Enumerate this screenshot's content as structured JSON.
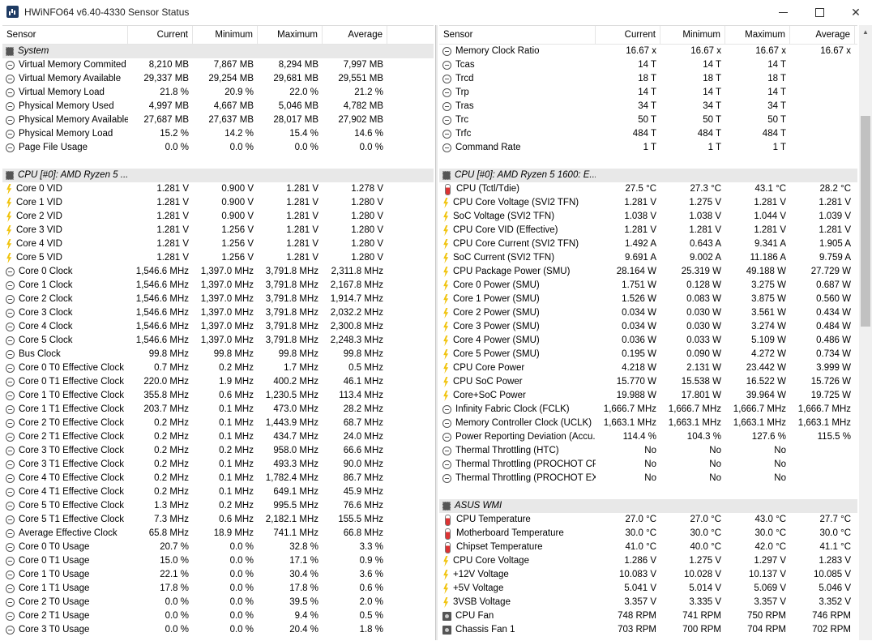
{
  "window": {
    "title": "HWiNFO64 v6.40-4330 Sensor Status",
    "minimize": "minimize",
    "maximize": "maximize",
    "close": "✕"
  },
  "columns": {
    "sensor": "Sensor",
    "current": "Current",
    "minimum": "Minimum",
    "maximum": "Maximum",
    "average": "Average"
  },
  "left_rows": [
    {
      "type": "group",
      "icon": "chip-icon",
      "name": "System"
    },
    {
      "type": "row",
      "icon": "mem-icon",
      "name": "Virtual Memory Commited",
      "current": "8,210 MB",
      "minimum": "7,867 MB",
      "maximum": "8,294 MB",
      "average": "7,997 MB"
    },
    {
      "type": "row",
      "icon": "mem-icon",
      "name": "Virtual Memory Available",
      "current": "29,337 MB",
      "minimum": "29,254 MB",
      "maximum": "29,681 MB",
      "average": "29,551 MB"
    },
    {
      "type": "row",
      "icon": "mem-icon",
      "name": "Virtual Memory Load",
      "current": "21.8 %",
      "minimum": "20.9 %",
      "maximum": "22.0 %",
      "average": "21.2 %"
    },
    {
      "type": "row",
      "icon": "mem-icon",
      "name": "Physical Memory Used",
      "current": "4,997 MB",
      "minimum": "4,667 MB",
      "maximum": "5,046 MB",
      "average": "4,782 MB"
    },
    {
      "type": "row",
      "icon": "mem-icon",
      "name": "Physical Memory Available",
      "current": "27,687 MB",
      "minimum": "27,637 MB",
      "maximum": "28,017 MB",
      "average": "27,902 MB"
    },
    {
      "type": "row",
      "icon": "mem-icon",
      "name": "Physical Memory Load",
      "current": "15.2 %",
      "minimum": "14.2 %",
      "maximum": "15.4 %",
      "average": "14.6 %"
    },
    {
      "type": "row",
      "icon": "mem-icon",
      "name": "Page File Usage",
      "current": "0.0 %",
      "minimum": "0.0 %",
      "maximum": "0.0 %",
      "average": "0.0 %"
    },
    {
      "type": "spacer"
    },
    {
      "type": "group",
      "icon": "chip-icon",
      "name": "CPU [#0]: AMD Ryzen 5 ..."
    },
    {
      "type": "row",
      "icon": "volt-icon",
      "name": "Core 0 VID",
      "current": "1.281 V",
      "minimum": "0.900 V",
      "maximum": "1.281 V",
      "average": "1.278 V"
    },
    {
      "type": "row",
      "icon": "volt-icon",
      "name": "Core 1 VID",
      "current": "1.281 V",
      "minimum": "0.900 V",
      "maximum": "1.281 V",
      "average": "1.280 V"
    },
    {
      "type": "row",
      "icon": "volt-icon",
      "name": "Core 2 VID",
      "current": "1.281 V",
      "minimum": "0.900 V",
      "maximum": "1.281 V",
      "average": "1.280 V"
    },
    {
      "type": "row",
      "icon": "volt-icon",
      "name": "Core 3 VID",
      "current": "1.281 V",
      "minimum": "1.256 V",
      "maximum": "1.281 V",
      "average": "1.280 V"
    },
    {
      "type": "row",
      "icon": "volt-icon",
      "name": "Core 4 VID",
      "current": "1.281 V",
      "minimum": "1.256 V",
      "maximum": "1.281 V",
      "average": "1.280 V"
    },
    {
      "type": "row",
      "icon": "volt-icon",
      "name": "Core 5 VID",
      "current": "1.281 V",
      "minimum": "1.256 V",
      "maximum": "1.281 V",
      "average": "1.280 V"
    },
    {
      "type": "row",
      "icon": "clock-icon",
      "name": "Core 0 Clock",
      "current": "1,546.6 MHz",
      "minimum": "1,397.0 MHz",
      "maximum": "3,791.8 MHz",
      "average": "2,311.8 MHz"
    },
    {
      "type": "row",
      "icon": "clock-icon",
      "name": "Core 1 Clock",
      "current": "1,546.6 MHz",
      "minimum": "1,397.0 MHz",
      "maximum": "3,791.8 MHz",
      "average": "2,167.8 MHz"
    },
    {
      "type": "row",
      "icon": "clock-icon",
      "name": "Core 2 Clock",
      "current": "1,546.6 MHz",
      "minimum": "1,397.0 MHz",
      "maximum": "3,791.8 MHz",
      "average": "1,914.7 MHz"
    },
    {
      "type": "row",
      "icon": "clock-icon",
      "name": "Core 3 Clock",
      "current": "1,546.6 MHz",
      "minimum": "1,397.0 MHz",
      "maximum": "3,791.8 MHz",
      "average": "2,032.2 MHz"
    },
    {
      "type": "row",
      "icon": "clock-icon",
      "name": "Core 4 Clock",
      "current": "1,546.6 MHz",
      "minimum": "1,397.0 MHz",
      "maximum": "3,791.8 MHz",
      "average": "2,300.8 MHz"
    },
    {
      "type": "row",
      "icon": "clock-icon",
      "name": "Core 5 Clock",
      "current": "1,546.6 MHz",
      "minimum": "1,397.0 MHz",
      "maximum": "3,791.8 MHz",
      "average": "2,248.3 MHz"
    },
    {
      "type": "row",
      "icon": "clock-icon",
      "name": "Bus Clock",
      "current": "99.8 MHz",
      "minimum": "99.8 MHz",
      "maximum": "99.8 MHz",
      "average": "99.8 MHz"
    },
    {
      "type": "row",
      "icon": "clock-icon",
      "name": "Core 0 T0 Effective Clock",
      "current": "0.7 MHz",
      "minimum": "0.2 MHz",
      "maximum": "1.7 MHz",
      "average": "0.5 MHz"
    },
    {
      "type": "row",
      "icon": "clock-icon",
      "name": "Core 0 T1 Effective Clock",
      "current": "220.0 MHz",
      "minimum": "1.9 MHz",
      "maximum": "400.2 MHz",
      "average": "46.1 MHz"
    },
    {
      "type": "row",
      "icon": "clock-icon",
      "name": "Core 1 T0 Effective Clock",
      "current": "355.8 MHz",
      "minimum": "0.6 MHz",
      "maximum": "1,230.5 MHz",
      "average": "113.4 MHz"
    },
    {
      "type": "row",
      "icon": "clock-icon",
      "name": "Core 1 T1 Effective Clock",
      "current": "203.7 MHz",
      "minimum": "0.1 MHz",
      "maximum": "473.0 MHz",
      "average": "28.2 MHz"
    },
    {
      "type": "row",
      "icon": "clock-icon",
      "name": "Core 2 T0 Effective Clock",
      "current": "0.2 MHz",
      "minimum": "0.1 MHz",
      "maximum": "1,443.9 MHz",
      "average": "68.7 MHz"
    },
    {
      "type": "row",
      "icon": "clock-icon",
      "name": "Core 2 T1 Effective Clock",
      "current": "0.2 MHz",
      "minimum": "0.1 MHz",
      "maximum": "434.7 MHz",
      "average": "24.0 MHz"
    },
    {
      "type": "row",
      "icon": "clock-icon",
      "name": "Core 3 T0 Effective Clock",
      "current": "0.2 MHz",
      "minimum": "0.2 MHz",
      "maximum": "958.0 MHz",
      "average": "66.6 MHz"
    },
    {
      "type": "row",
      "icon": "clock-icon",
      "name": "Core 3 T1 Effective Clock",
      "current": "0.2 MHz",
      "minimum": "0.1 MHz",
      "maximum": "493.3 MHz",
      "average": "90.0 MHz"
    },
    {
      "type": "row",
      "icon": "clock-icon",
      "name": "Core 4 T0 Effective Clock",
      "current": "0.2 MHz",
      "minimum": "0.1 MHz",
      "maximum": "1,782.4 MHz",
      "average": "86.7 MHz"
    },
    {
      "type": "row",
      "icon": "clock-icon",
      "name": "Core 4 T1 Effective Clock",
      "current": "0.2 MHz",
      "minimum": "0.1 MHz",
      "maximum": "649.1 MHz",
      "average": "45.9 MHz"
    },
    {
      "type": "row",
      "icon": "clock-icon",
      "name": "Core 5 T0 Effective Clock",
      "current": "1.3 MHz",
      "minimum": "0.2 MHz",
      "maximum": "995.5 MHz",
      "average": "76.6 MHz"
    },
    {
      "type": "row",
      "icon": "clock-icon",
      "name": "Core 5 T1 Effective Clock",
      "current": "7.3 MHz",
      "minimum": "0.6 MHz",
      "maximum": "2,182.1 MHz",
      "average": "155.5 MHz"
    },
    {
      "type": "row",
      "icon": "clock-icon",
      "name": "Average Effective Clock",
      "current": "65.8 MHz",
      "minimum": "18.9 MHz",
      "maximum": "741.1 MHz",
      "average": "66.8 MHz"
    },
    {
      "type": "row",
      "icon": "usage-icon",
      "name": "Core 0 T0 Usage",
      "current": "20.7 %",
      "minimum": "0.0 %",
      "maximum": "32.8 %",
      "average": "3.3 %"
    },
    {
      "type": "row",
      "icon": "usage-icon",
      "name": "Core 0 T1 Usage",
      "current": "15.0 %",
      "minimum": "0.0 %",
      "maximum": "17.1 %",
      "average": "0.9 %"
    },
    {
      "type": "row",
      "icon": "usage-icon",
      "name": "Core 1 T0 Usage",
      "current": "22.1 %",
      "minimum": "0.0 %",
      "maximum": "30.4 %",
      "average": "3.6 %"
    },
    {
      "type": "row",
      "icon": "usage-icon",
      "name": "Core 1 T1 Usage",
      "current": "17.8 %",
      "minimum": "0.0 %",
      "maximum": "17.8 %",
      "average": "0.6 %"
    },
    {
      "type": "row",
      "icon": "usage-icon",
      "name": "Core 2 T0 Usage",
      "current": "0.0 %",
      "minimum": "0.0 %",
      "maximum": "39.5 %",
      "average": "2.0 %"
    },
    {
      "type": "row",
      "icon": "usage-icon",
      "name": "Core 2 T1 Usage",
      "current": "0.0 %",
      "minimum": "0.0 %",
      "maximum": "9.4 %",
      "average": "0.5 %"
    },
    {
      "type": "row",
      "icon": "usage-icon",
      "name": "Core 3 T0 Usage",
      "current": "0.0 %",
      "minimum": "0.0 %",
      "maximum": "20.4 %",
      "average": "1.8 %"
    }
  ],
  "right_rows": [
    {
      "type": "row",
      "icon": "clock-icon",
      "name": "Memory Clock Ratio",
      "current": "16.67 x",
      "minimum": "16.67 x",
      "maximum": "16.67 x",
      "average": "16.67 x"
    },
    {
      "type": "row",
      "icon": "clock-icon",
      "name": "Tcas",
      "current": "14 T",
      "minimum": "14 T",
      "maximum": "14 T",
      "average": ""
    },
    {
      "type": "row",
      "icon": "clock-icon",
      "name": "Trcd",
      "current": "18 T",
      "minimum": "18 T",
      "maximum": "18 T",
      "average": ""
    },
    {
      "type": "row",
      "icon": "clock-icon",
      "name": "Trp",
      "current": "14 T",
      "minimum": "14 T",
      "maximum": "14 T",
      "average": ""
    },
    {
      "type": "row",
      "icon": "clock-icon",
      "name": "Tras",
      "current": "34 T",
      "minimum": "34 T",
      "maximum": "34 T",
      "average": ""
    },
    {
      "type": "row",
      "icon": "clock-icon",
      "name": "Trc",
      "current": "50 T",
      "minimum": "50 T",
      "maximum": "50 T",
      "average": ""
    },
    {
      "type": "row",
      "icon": "clock-icon",
      "name": "Trfc",
      "current": "484 T",
      "minimum": "484 T",
      "maximum": "484 T",
      "average": ""
    },
    {
      "type": "row",
      "icon": "clock-icon",
      "name": "Command Rate",
      "current": "1 T",
      "minimum": "1 T",
      "maximum": "1 T",
      "average": ""
    },
    {
      "type": "spacer"
    },
    {
      "type": "group",
      "icon": "chip-icon",
      "name": "CPU [#0]: AMD Ryzen 5 1600: E..."
    },
    {
      "type": "row",
      "icon": "temp-icon",
      "name": "CPU (Tctl/Tdie)",
      "current": "27.5 °C",
      "minimum": "27.3 °C",
      "maximum": "43.1 °C",
      "average": "28.2 °C"
    },
    {
      "type": "row",
      "icon": "volt-icon",
      "name": "CPU Core Voltage (SVI2 TFN)",
      "current": "1.281 V",
      "minimum": "1.275 V",
      "maximum": "1.281 V",
      "average": "1.281 V"
    },
    {
      "type": "row",
      "icon": "volt-icon",
      "name": "SoC Voltage (SVI2 TFN)",
      "current": "1.038 V",
      "minimum": "1.038 V",
      "maximum": "1.044 V",
      "average": "1.039 V"
    },
    {
      "type": "row",
      "icon": "volt-icon",
      "name": "CPU Core VID (Effective)",
      "current": "1.281 V",
      "minimum": "1.281 V",
      "maximum": "1.281 V",
      "average": "1.281 V"
    },
    {
      "type": "row",
      "icon": "volt-icon",
      "name": "CPU Core Current (SVI2 TFN)",
      "current": "1.492 A",
      "minimum": "0.643 A",
      "maximum": "9.341 A",
      "average": "1.905 A"
    },
    {
      "type": "row",
      "icon": "volt-icon",
      "name": "SoC Current (SVI2 TFN)",
      "current": "9.691 A",
      "minimum": "9.002 A",
      "maximum": "11.186 A",
      "average": "9.759 A"
    },
    {
      "type": "row",
      "icon": "power-icon",
      "name": "CPU Package Power (SMU)",
      "current": "28.164 W",
      "minimum": "25.319 W",
      "maximum": "49.188 W",
      "average": "27.729 W"
    },
    {
      "type": "row",
      "icon": "power-icon",
      "name": "Core 0 Power (SMU)",
      "current": "1.751 W",
      "minimum": "0.128 W",
      "maximum": "3.275 W",
      "average": "0.687 W"
    },
    {
      "type": "row",
      "icon": "power-icon",
      "name": "Core 1 Power (SMU)",
      "current": "1.526 W",
      "minimum": "0.083 W",
      "maximum": "3.875 W",
      "average": "0.560 W"
    },
    {
      "type": "row",
      "icon": "power-icon",
      "name": "Core 2 Power (SMU)",
      "current": "0.034 W",
      "minimum": "0.030 W",
      "maximum": "3.561 W",
      "average": "0.434 W"
    },
    {
      "type": "row",
      "icon": "power-icon",
      "name": "Core 3 Power (SMU)",
      "current": "0.034 W",
      "minimum": "0.030 W",
      "maximum": "3.274 W",
      "average": "0.484 W"
    },
    {
      "type": "row",
      "icon": "power-icon",
      "name": "Core 4 Power (SMU)",
      "current": "0.036 W",
      "minimum": "0.033 W",
      "maximum": "5.109 W",
      "average": "0.486 W"
    },
    {
      "type": "row",
      "icon": "power-icon",
      "name": "Core 5 Power (SMU)",
      "current": "0.195 W",
      "minimum": "0.090 W",
      "maximum": "4.272 W",
      "average": "0.734 W"
    },
    {
      "type": "row",
      "icon": "power-icon",
      "name": "CPU Core Power",
      "current": "4.218 W",
      "minimum": "2.131 W",
      "maximum": "23.442 W",
      "average": "3.999 W"
    },
    {
      "type": "row",
      "icon": "power-icon",
      "name": "CPU SoC Power",
      "current": "15.770 W",
      "minimum": "15.538 W",
      "maximum": "16.522 W",
      "average": "15.726 W"
    },
    {
      "type": "row",
      "icon": "power-icon",
      "name": "Core+SoC Power",
      "current": "19.988 W",
      "minimum": "17.801 W",
      "maximum": "39.964 W",
      "average": "19.725 W"
    },
    {
      "type": "row",
      "icon": "clock-icon",
      "name": "Infinity Fabric Clock (FCLK)",
      "current": "1,666.7 MHz",
      "minimum": "1,666.7 MHz",
      "maximum": "1,666.7 MHz",
      "average": "1,666.7 MHz"
    },
    {
      "type": "row",
      "icon": "clock-icon",
      "name": "Memory Controller Clock (UCLK)",
      "current": "1,663.1 MHz",
      "minimum": "1,663.1 MHz",
      "maximum": "1,663.1 MHz",
      "average": "1,663.1 MHz"
    },
    {
      "type": "row",
      "icon": "usage-icon",
      "name": "Power Reporting Deviation (Accu...",
      "current": "114.4 %",
      "minimum": "104.3 %",
      "maximum": "127.6 %",
      "average": "115.5 %"
    },
    {
      "type": "row",
      "icon": "usage-icon",
      "name": "Thermal Throttling (HTC)",
      "current": "No",
      "minimum": "No",
      "maximum": "No",
      "average": ""
    },
    {
      "type": "row",
      "icon": "usage-icon",
      "name": "Thermal Throttling (PROCHOT CPU)",
      "current": "No",
      "minimum": "No",
      "maximum": "No",
      "average": ""
    },
    {
      "type": "row",
      "icon": "usage-icon",
      "name": "Thermal Throttling (PROCHOT EXT)",
      "current": "No",
      "minimum": "No",
      "maximum": "No",
      "average": ""
    },
    {
      "type": "spacer"
    },
    {
      "type": "group",
      "icon": "chip-icon",
      "name": "ASUS WMI"
    },
    {
      "type": "row",
      "icon": "temp-icon",
      "name": "CPU Temperature",
      "current": "27.0 °C",
      "minimum": "27.0 °C",
      "maximum": "43.0 °C",
      "average": "27.7 °C"
    },
    {
      "type": "row",
      "icon": "temp-icon",
      "name": "Motherboard Temperature",
      "current": "30.0 °C",
      "minimum": "30.0 °C",
      "maximum": "30.0 °C",
      "average": "30.0 °C"
    },
    {
      "type": "row",
      "icon": "temp-icon",
      "name": "Chipset Temperature",
      "current": "41.0 °C",
      "minimum": "40.0 °C",
      "maximum": "42.0 °C",
      "average": "41.1 °C"
    },
    {
      "type": "row",
      "icon": "volt-icon",
      "name": "CPU Core Voltage",
      "current": "1.286 V",
      "minimum": "1.275 V",
      "maximum": "1.297 V",
      "average": "1.283 V"
    },
    {
      "type": "row",
      "icon": "volt-icon",
      "name": "+12V Voltage",
      "current": "10.083 V",
      "minimum": "10.028 V",
      "maximum": "10.137 V",
      "average": "10.085 V"
    },
    {
      "type": "row",
      "icon": "volt-icon",
      "name": "+5V Voltage",
      "current": "5.041 V",
      "minimum": "5.014 V",
      "maximum": "5.069 V",
      "average": "5.046 V"
    },
    {
      "type": "row",
      "icon": "volt-icon",
      "name": "3VSB Voltage",
      "current": "3.357 V",
      "minimum": "3.335 V",
      "maximum": "3.357 V",
      "average": "3.352 V"
    },
    {
      "type": "row",
      "icon": "fan-icon",
      "name": "CPU Fan",
      "current": "748 RPM",
      "minimum": "741 RPM",
      "maximum": "750 RPM",
      "average": "746 RPM"
    },
    {
      "type": "row",
      "icon": "fan-icon",
      "name": "Chassis Fan 1",
      "current": "703 RPM",
      "minimum": "700 RPM",
      "maximum": "704 RPM",
      "average": "702 RPM"
    }
  ]
}
